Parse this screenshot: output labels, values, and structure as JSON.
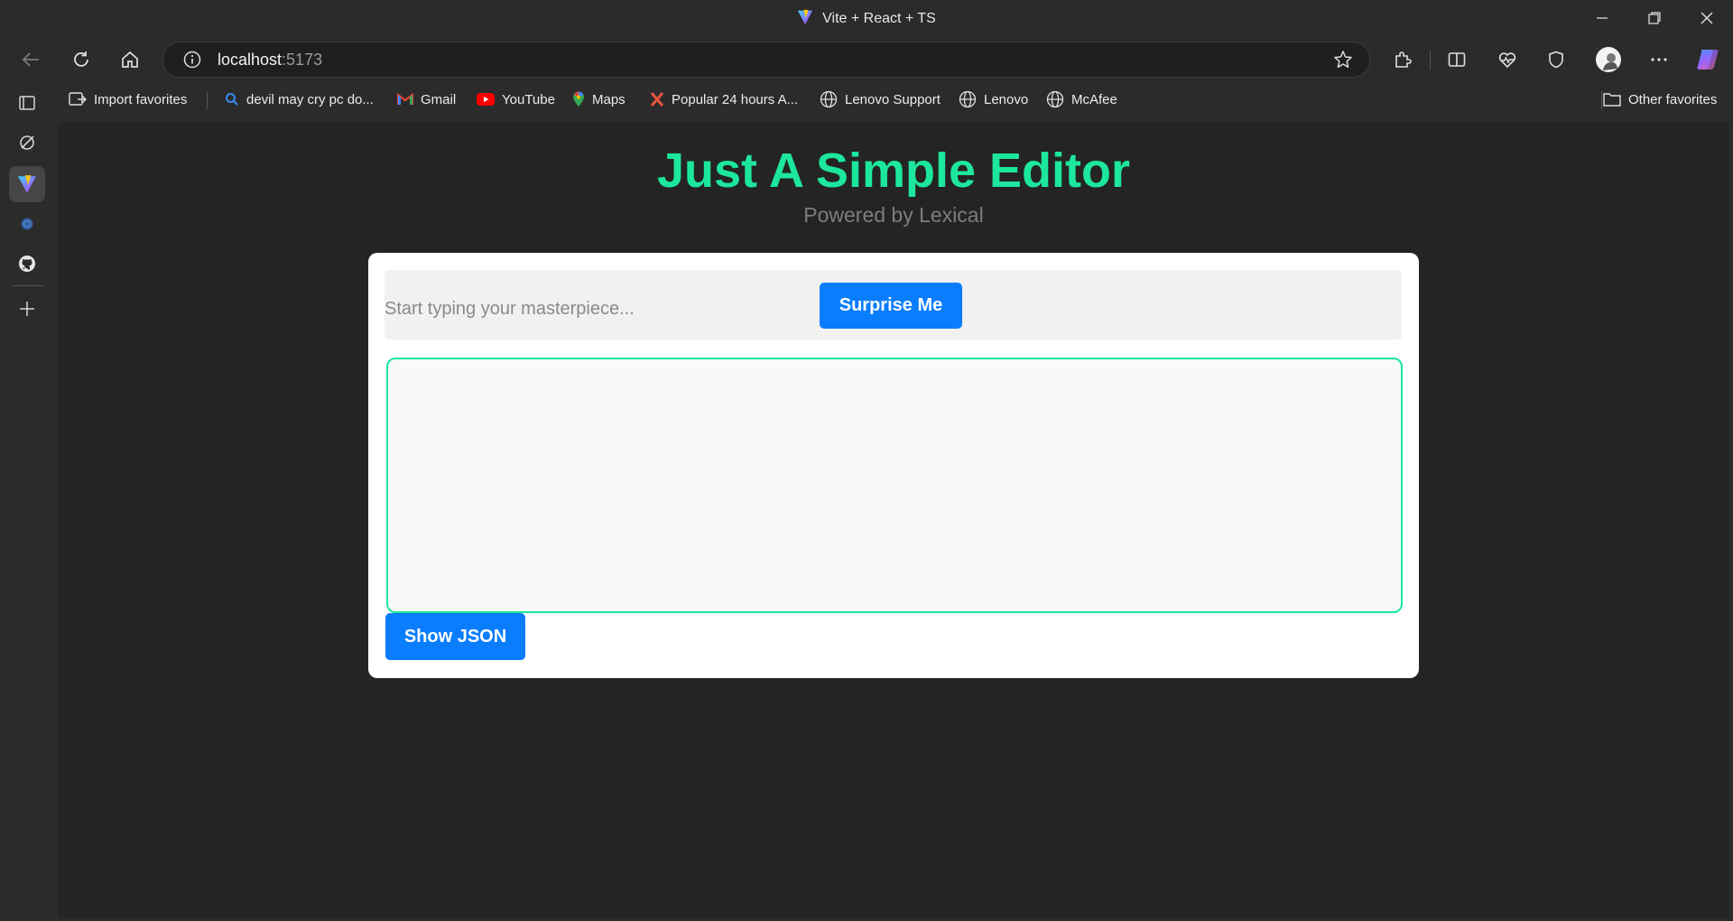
{
  "window": {
    "title": "Vite + React + TS",
    "controls": [
      "minimize",
      "restore",
      "close"
    ]
  },
  "nav": {
    "back_icon": "back-arrow-icon",
    "reload_icon": "reload-icon",
    "home_icon": "home-icon",
    "url_host": "localhost",
    "url_port": ":5173"
  },
  "favorites": {
    "items": [
      {
        "label": "Import favorites",
        "icon": "import-icon"
      },
      {
        "label": "devil may cry pc do...",
        "icon": "search-icon"
      },
      {
        "label": "Gmail",
        "icon": "gmail-icon"
      },
      {
        "label": "YouTube",
        "icon": "youtube-icon"
      },
      {
        "label": "Maps",
        "icon": "maps-icon"
      },
      {
        "label": "Popular 24 hours A...",
        "icon": "x-icon"
      },
      {
        "label": "Lenovo Support",
        "icon": "globe-icon"
      },
      {
        "label": "Lenovo",
        "icon": "globe-icon"
      },
      {
        "label": "McAfee",
        "icon": "globe-icon"
      }
    ],
    "other": "Other favorites"
  },
  "page": {
    "heading": "Just A Simple Editor",
    "subheading": "Powered by Lexical",
    "placeholder": "Start typing your masterpiece...",
    "surprise_label": "Surprise Me",
    "show_json_label": "Show JSON",
    "editor_content": ""
  },
  "colors": {
    "accent": "#1ce79c",
    "button": "#0a7dfc",
    "page_bg": "#242424",
    "chrome_bg": "#2b2b2b"
  }
}
